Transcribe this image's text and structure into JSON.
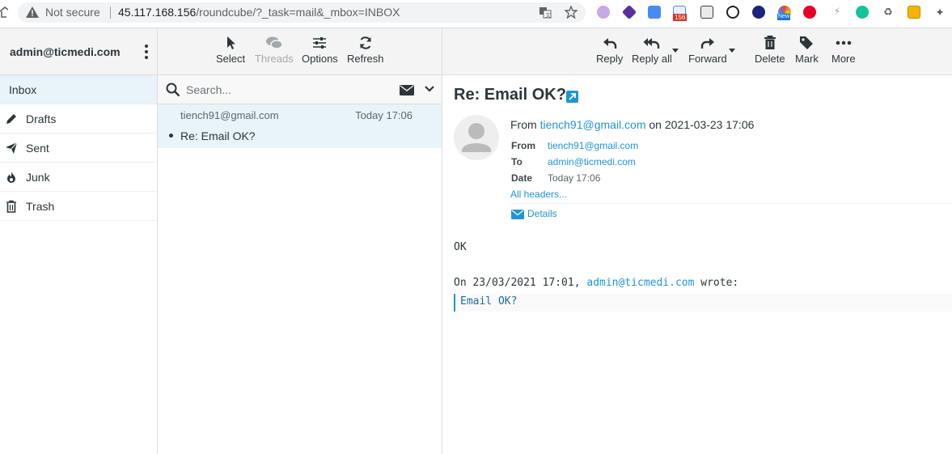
{
  "browser": {
    "security": "Not secure",
    "url_host": "45.117.168.156",
    "url_path": "/roundcube/?_task=mail&_mbox=INBOX",
    "ext_badge_count": "156",
    "ext_new_label": "New"
  },
  "sidebar": {
    "account": "admin@ticmedi.com",
    "folders": [
      {
        "label": "Inbox",
        "icon": "inbox-icon",
        "active": true
      },
      {
        "label": "Drafts",
        "icon": "pencil-icon"
      },
      {
        "label": "Sent",
        "icon": "paper-plane-icon"
      },
      {
        "label": "Junk",
        "icon": "fire-icon"
      },
      {
        "label": "Trash",
        "icon": "trash-icon"
      }
    ]
  },
  "list_toolbar": {
    "select": "Select",
    "threads": "Threads",
    "options": "Options",
    "refresh": "Refresh"
  },
  "search": {
    "placeholder": "Search..."
  },
  "messages": [
    {
      "from": "tiench91@gmail.com",
      "date": "Today 17:06",
      "subject": "Re: Email OK?"
    }
  ],
  "mail_toolbar": {
    "reply": "Reply",
    "reply_all": "Reply all",
    "forward": "Forward",
    "delete": "Delete",
    "mark": "Mark",
    "more": "More"
  },
  "mail": {
    "subject": "Re: Email OK?",
    "from_prefix": "From",
    "from_addr": "tiench91@gmail.com",
    "from_suffix": "on 2021-03-23 17:06",
    "headers": {
      "from_label": "From",
      "from_value": "tiench91@gmail.com",
      "to_label": "To",
      "to_value": "admin@ticmedi.com",
      "date_label": "Date",
      "date_value": "Today 17:06"
    },
    "all_headers": "All headers...",
    "details": "Details",
    "body": "OK",
    "attrib_prefix": "On 23/03/2021 17:01,",
    "attrib_addr": "admin@ticmedi.com",
    "attrib_suffix": "wrote:",
    "quote": "Email OK?"
  },
  "colors": {
    "accent": "#1f95d8",
    "active_bg": "#e8f3fa",
    "header_bg": "#f4f4f4"
  }
}
